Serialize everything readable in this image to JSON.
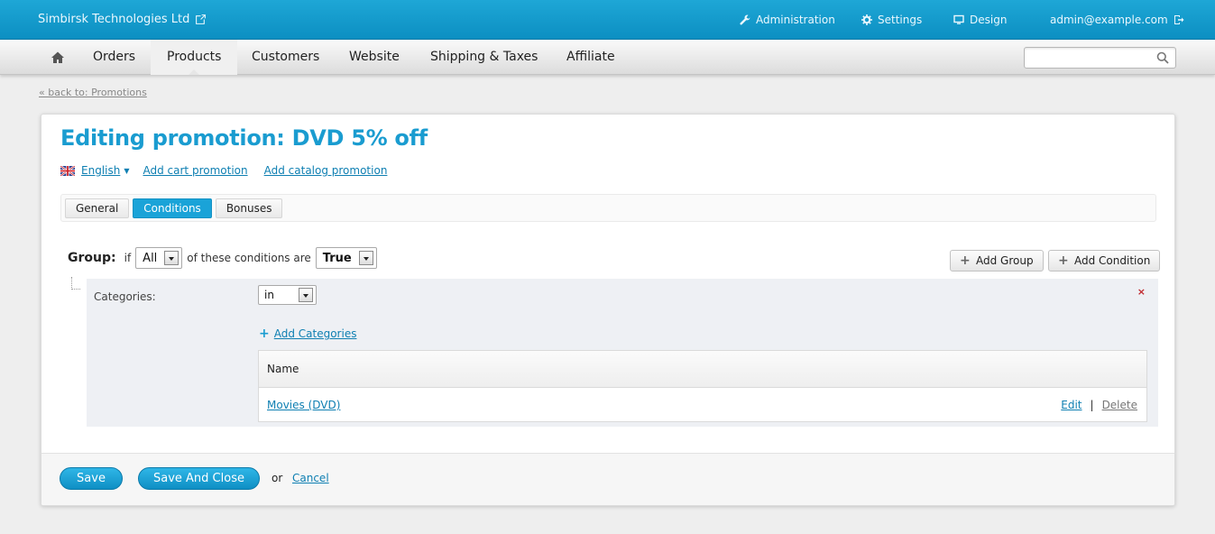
{
  "topbar": {
    "company": "Simbirsk Technologies Ltd",
    "administration": "Administration",
    "settings": "Settings",
    "design": "Design",
    "user": "admin@example.com"
  },
  "nav": {
    "items": [
      "Orders",
      "Products",
      "Customers",
      "Website",
      "Shipping & Taxes",
      "Affiliate"
    ],
    "active": "Products",
    "search_value": ""
  },
  "back_link": "« back to: Promotions",
  "page": {
    "title": "Editing promotion: DVD 5% off",
    "language": "English",
    "add_cart_promotion": "Add cart promotion",
    "add_catalog_promotion": "Add catalog promotion",
    "tabs": [
      "General",
      "Conditions",
      "Bonuses"
    ],
    "active_tab": "Conditions"
  },
  "group": {
    "label": "Group:",
    "if_text": "if",
    "quantifier": "All",
    "middle_text": "of these conditions are",
    "truth": "True",
    "add_group": "Add Group",
    "add_condition": "Add Condition"
  },
  "condition": {
    "label": "Categories:",
    "operator": "in",
    "add_categories": "Add Categories",
    "table_header": "Name",
    "rows": [
      {
        "name": "Movies (DVD)",
        "edit": "Edit",
        "delete": "Delete"
      }
    ],
    "remove_symbol": "×"
  },
  "footer": {
    "save": "Save",
    "save_close": "Save And Close",
    "or": "or",
    "cancel": "Cancel"
  },
  "colors": {
    "accent": "#1a9cd0",
    "topbar": "#1ea7d6",
    "remove": "#c0282d"
  }
}
